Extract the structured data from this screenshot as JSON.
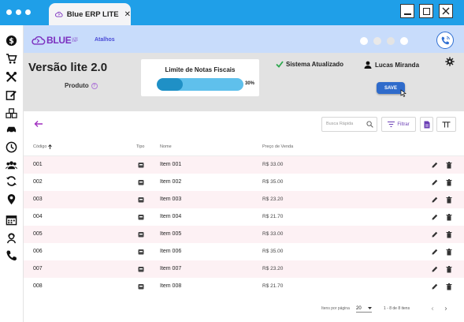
{
  "window": {
    "tab_title": "Blue ERP LITE",
    "tab_close": "✕"
  },
  "nav_icons": [
    "dollar-icon",
    "cart-icon",
    "tools-icon",
    "edit-icon",
    "boxes-icon",
    "car-icon",
    "clock-icon",
    "users-icon",
    "sync-icon",
    "location-icon",
    "calendar-icon",
    "support-agent-icon",
    "phone-icon"
  ],
  "appbar": {
    "logo_text": "BLUE",
    "logo_small": "LITE ERP",
    "shortcuts_label": "Atalhos",
    "dots": [
      "#ffffff",
      "#e9e9e9",
      "#e4e4e4",
      "#ffffff"
    ]
  },
  "info": {
    "version_title": "Versão lite 2.0",
    "product_label": "Produto",
    "help_mark": "?",
    "limit_title": "Limite de Notas Fiscais",
    "limit_percent_label": "30%",
    "limit_fraction": 0.3,
    "sync_status": "Sistema Atualizado",
    "user_name": "Lucas Miranda",
    "save_label": "SAVE"
  },
  "toolbar": {
    "search_placeholder": "Busca Rápida",
    "filter_label": "Filtrar"
  },
  "table": {
    "columns": {
      "code": "Código",
      "type": "Tipo",
      "name": "Nome",
      "price": "Preço de Venda"
    },
    "rows": [
      {
        "code": "001",
        "name": "Item 001",
        "price": "R$ 33.00"
      },
      {
        "code": "002",
        "name": "Item 002",
        "price": "R$ 35.00"
      },
      {
        "code": "003",
        "name": "Item 003",
        "price": "R$ 23.20"
      },
      {
        "code": "004",
        "name": "Item 004",
        "price": "R$ 21.70"
      },
      {
        "code": "005",
        "name": "Item 005",
        "price": "R$ 33.00"
      },
      {
        "code": "006",
        "name": "Item 006",
        "price": "R$ 35.00"
      },
      {
        "code": "007",
        "name": "Item 007",
        "price": "R$ 23.20"
      },
      {
        "code": "008",
        "name": "Item 008",
        "price": "R$ 21.70"
      }
    ]
  },
  "footer": {
    "rows_per_page_label": "Itens por página",
    "rows_per_page_value": "20",
    "range_text": "1 - 8 de 8 itens"
  },
  "colors": {
    "accent": "#1f9fe8",
    "brand": "#7b2fbf",
    "save": "#2f6bcb"
  }
}
